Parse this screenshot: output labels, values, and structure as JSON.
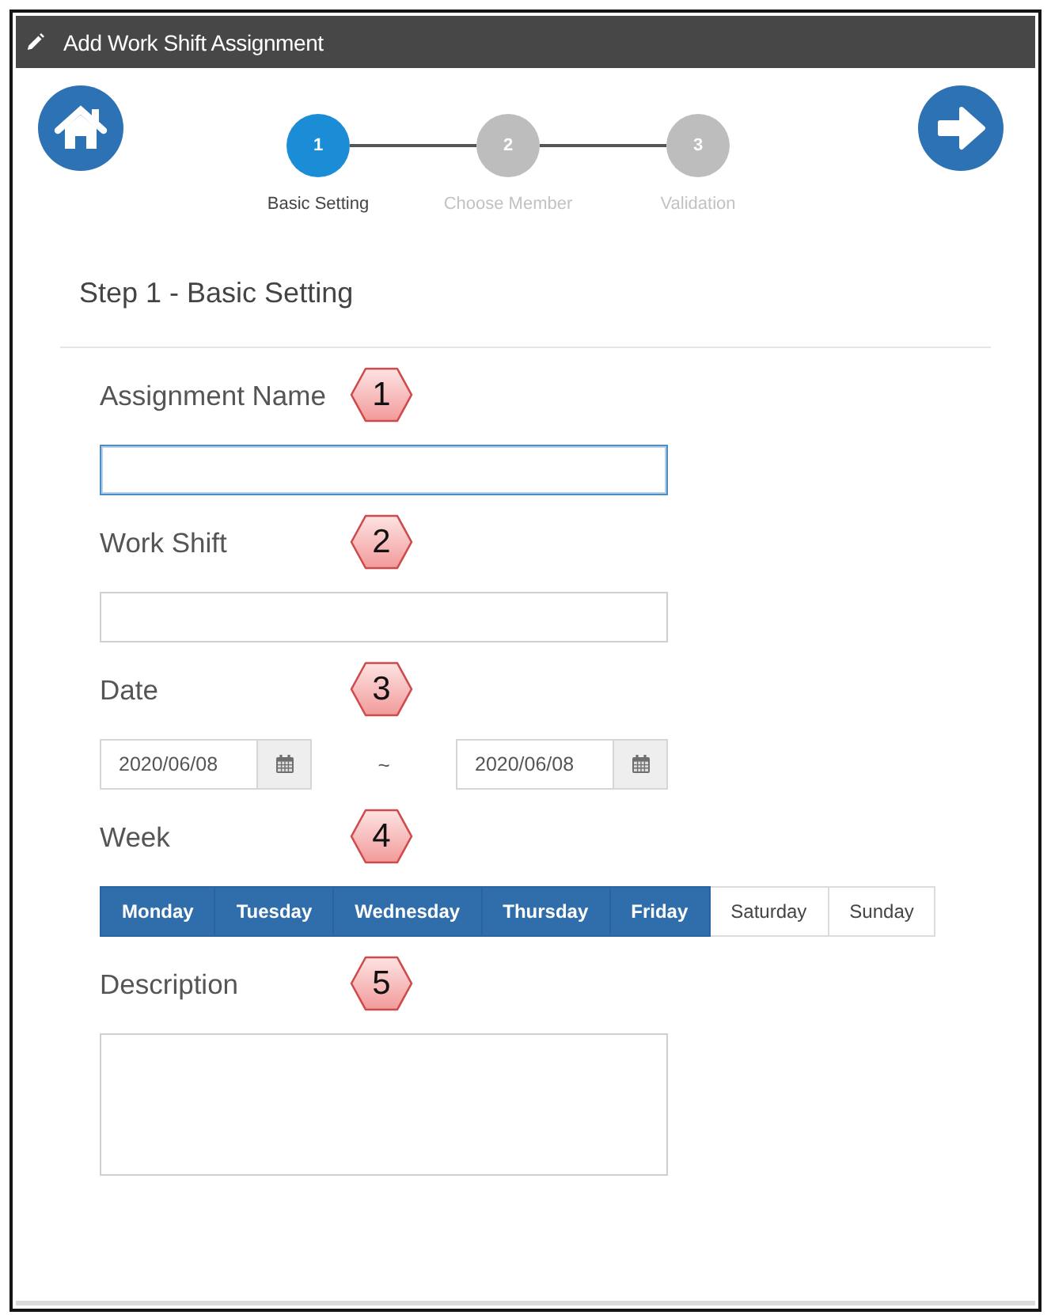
{
  "window": {
    "title": "Add Work Shift Assignment"
  },
  "steps": [
    {
      "number": "1",
      "label": "Basic Setting",
      "selected": true
    },
    {
      "number": "2",
      "label": "Choose Member",
      "selected": false
    },
    {
      "number": "3",
      "label": "Validation",
      "selected": false
    }
  ],
  "section_title": "Step 1 - Basic Setting",
  "fields": [
    {
      "kind": "text",
      "label": "Assignment Name",
      "callout": "1",
      "focused": true
    },
    {
      "kind": "text",
      "label": "Work Shift",
      "callout": "2",
      "focused": false
    },
    {
      "kind": "date_range",
      "label": "Date",
      "callout": "3",
      "focused": false,
      "start": "2020/06/08",
      "separator": "~",
      "end": "2020/06/08"
    },
    {
      "kind": "weekdays",
      "label": "Week",
      "callout": "4",
      "days": [
        {
          "label": "Monday",
          "selected": true
        },
        {
          "label": "Tuesday",
          "selected": true
        },
        {
          "label": "Wednesday",
          "selected": true
        },
        {
          "label": "Thursday",
          "selected": true
        },
        {
          "label": "Friday",
          "selected": true
        },
        {
          "label": "Saturday",
          "selected": false
        },
        {
          "label": "Sunday",
          "selected": false
        }
      ]
    },
    {
      "kind": "textarea",
      "label": "Description",
      "callout": "5",
      "focused": false
    }
  ]
}
